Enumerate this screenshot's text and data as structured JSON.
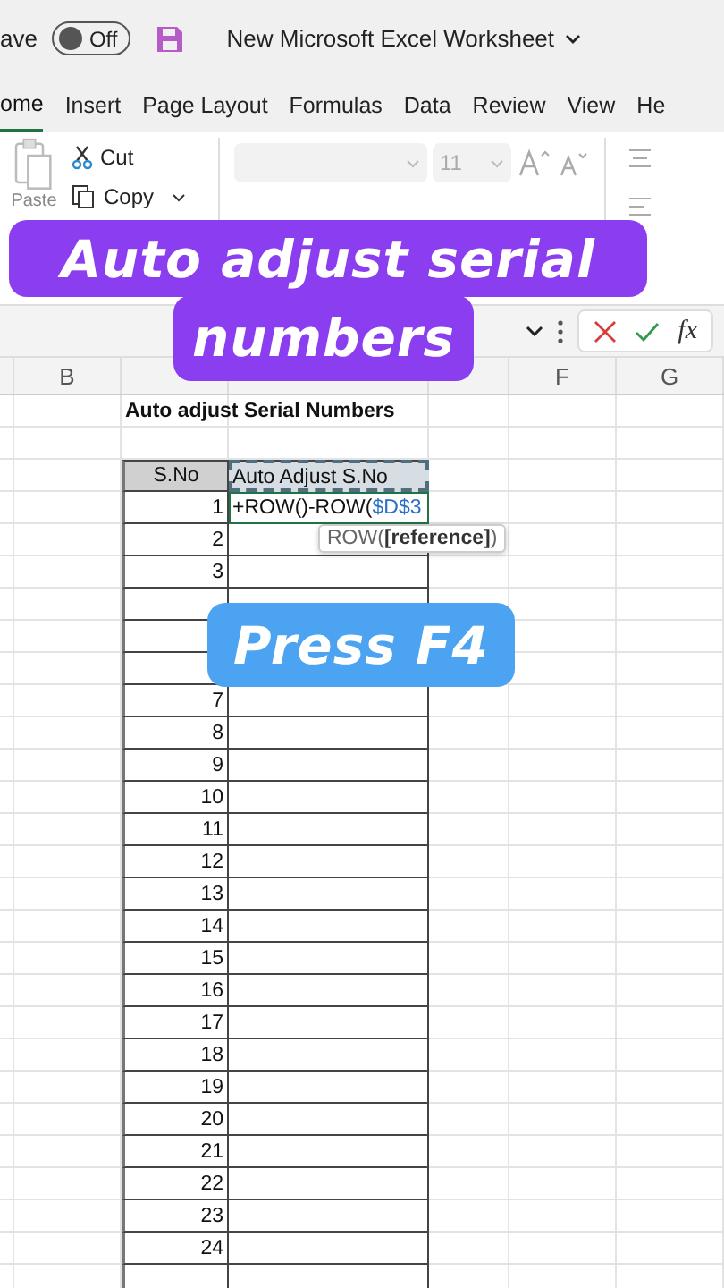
{
  "title_bar": {
    "autosave_label": "ave",
    "autosave_on": false,
    "autosave_state": "Off",
    "document_title": "New Microsoft Excel Worksheet"
  },
  "tabs": [
    {
      "label": "ome",
      "selected": true
    },
    {
      "label": "Insert",
      "selected": false
    },
    {
      "label": "Page Layout",
      "selected": false
    },
    {
      "label": "Formulas",
      "selected": false
    },
    {
      "label": "Data",
      "selected": false
    },
    {
      "label": "Review",
      "selected": false
    },
    {
      "label": "View",
      "selected": false
    },
    {
      "label": "He",
      "selected": false
    }
  ],
  "ribbon": {
    "paste": "Paste",
    "cut": "Cut",
    "copy": "Copy",
    "font_size": "11"
  },
  "formula_bar": {
    "function_label": "fx"
  },
  "column_headers": [
    "B",
    "F",
    "G"
  ],
  "sheet": {
    "title": "Auto adjust Serial Numbers",
    "header_sno": "S.No",
    "header_auto": "Auto Adjust S.No",
    "header_auto_copied": true,
    "editing_formula": "+ROW()-ROW(",
    "editing_reference": "$D$3",
    "tooltip": "ROW(**[reference]**)",
    "serials_above_caption": [
      "1",
      "2",
      "3"
    ],
    "serials_below_caption": [
      "7",
      "8",
      "9",
      "10",
      "11",
      "12",
      "13",
      "14",
      "15",
      "16",
      "17",
      "18",
      "19",
      "20",
      "21",
      "22",
      "23",
      "24"
    ]
  },
  "captions": [
    {
      "lines": [
        "Auto adjust serial",
        "numbers"
      ],
      "color": "#8b3ef0"
    },
    {
      "lines": [
        "Press F4"
      ],
      "color": "#4ba3f2"
    }
  ]
}
